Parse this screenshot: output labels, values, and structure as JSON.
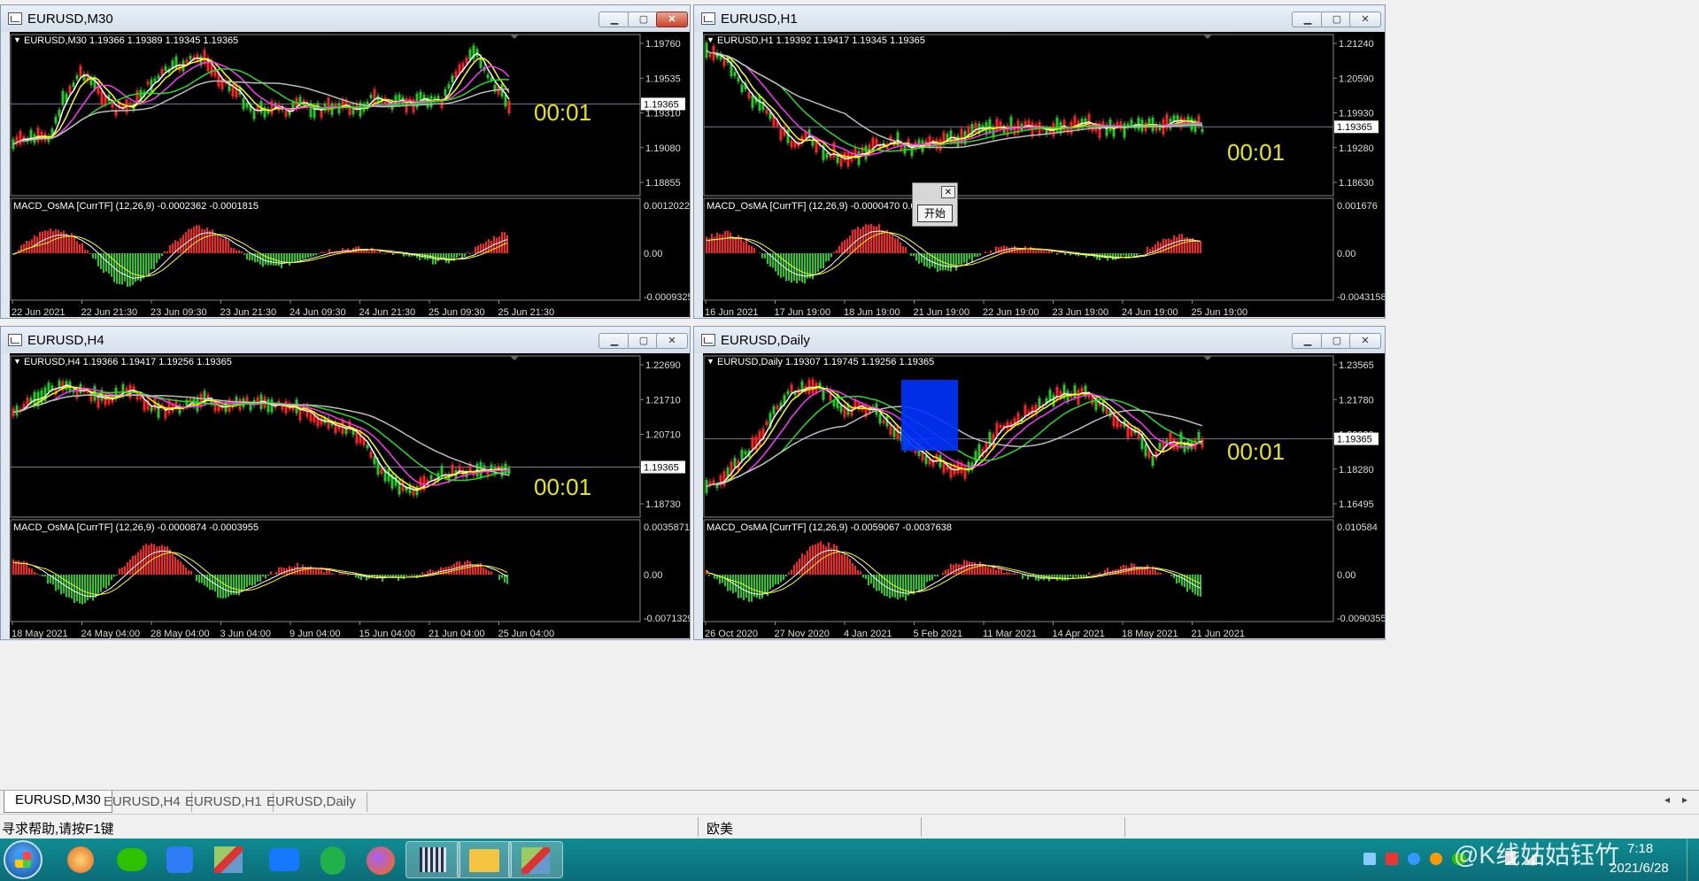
{
  "windows": [
    {
      "id": "m30",
      "title": "EURUSD,M30",
      "info": "EURUSD,M30  1.19366 1.19389 1.19345 1.19365",
      "price_ticks": [
        "1.19760",
        "1.19535",
        "1.19310",
        "1.19080",
        "1.18855"
      ],
      "current_price": "1.19365",
      "macd_label": "MACD_OsMA [CurrTF] (12,26,9) -0.0002362 -0.0001815",
      "macd_ticks": [
        "0.0012022",
        "0.00",
        "-0.0009325"
      ],
      "time_ticks": [
        "22 Jun 2021",
        "22 Jun 21:30",
        "23 Jun 09:30",
        "23 Jun 21:30",
        "24 Jun 09:30",
        "24 Jun 21:30",
        "25 Jun 09:30",
        "25 Jun 21:30"
      ],
      "timer": "00:01",
      "close_active": true
    },
    {
      "id": "h1",
      "title": "EURUSD,H1",
      "info": "EURUSD,H1  1.19392 1.19417 1.19345 1.19365",
      "price_ticks": [
        "1.21240",
        "1.20590",
        "1.19930",
        "1.19280",
        "1.18630"
      ],
      "current_price": "1.19365",
      "macd_label": "MACD_OsMA [CurrTF] (12,26,9) -0.0000470 0.0003",
      "macd_ticks": [
        "0.001676",
        "0.00",
        "-0.0043158"
      ],
      "time_ticks": [
        "16 Jun 2021",
        "17 Jun 19:00",
        "18 Jun 19:00",
        "21 Jun 19:00",
        "22 Jun 19:00",
        "23 Jun 19:00",
        "24 Jun 19:00",
        "25 Jun 19:00"
      ],
      "timer": "00:01",
      "close_active": false
    },
    {
      "id": "h4",
      "title": "EURUSD,H4",
      "info": "EURUSD,H4  1.19366 1.19417 1.19256 1.19365",
      "price_ticks": [
        "1.22690",
        "1.21710",
        "1.20710",
        "1.19710",
        "1.18730"
      ],
      "current_price": "1.19365",
      "macd_label": "MACD_OsMA [CurrTF] (12,26,9) -0.0000874 -0.0003955",
      "macd_ticks": [
        "0.0035871",
        "0.00",
        "-0.0071329"
      ],
      "time_ticks": [
        "18 May 2021",
        "24 May 04:00",
        "28 May 04:00",
        "3 Jun 04:00",
        "9 Jun 04:00",
        "15 Jun 04:00",
        "21 Jun 04:00",
        "25 Jun 04:00"
      ],
      "timer": "00:01",
      "close_active": false
    },
    {
      "id": "d1",
      "title": "EURUSD,Daily",
      "info": "EURUSD,Daily  1.19307 1.19745 1.19256 1.19365",
      "price_ticks": [
        "1.23565",
        "1.21780",
        "1.20030",
        "1.18280",
        "1.16495"
      ],
      "current_price": "1.19365",
      "macd_label": "MACD_OsMA [CurrTF] (12,26,9) -0.0059067 -0.0037638",
      "macd_ticks": [
        "0.010584",
        "0.00",
        "-0.0090355"
      ],
      "time_ticks": [
        "26 Oct 2020",
        "27 Nov 2020",
        "4 Jan 2021",
        "5 Feb 2021",
        "11 Mar 2021",
        "14 Apr 2021",
        "18 May 2021",
        "21 Jun 2021"
      ],
      "timer": "00:01",
      "close_active": false
    }
  ],
  "popup": {
    "button_label": "开始",
    "close_glyph": "✕"
  },
  "window_buttons": {
    "minimize": "▁",
    "maximize": "▢",
    "close": "✕"
  },
  "tabs": [
    "EURUSD,M30",
    "EURUSD,H4",
    "EURUSD,H1",
    "EURUSD,Daily"
  ],
  "tab_scroll": {
    "left": "◂",
    "right": "▸"
  },
  "status": {
    "help": "寻求帮助,请按F1键",
    "profile": "欧美"
  },
  "taskbar": {
    "time": "7:18",
    "date": "2021/6/28",
    "watermark": "@K线姑姑钰竹"
  },
  "colors": {
    "bull": "#ff2222",
    "bear": "#22cc22",
    "ma_fast": "#ffff00",
    "ma_mid": "#ff33ff",
    "ma_slow": "#22dd22",
    "ma_long": "#bbbbbb",
    "timer": "#e8e800",
    "highlight": "#0033ff"
  }
}
